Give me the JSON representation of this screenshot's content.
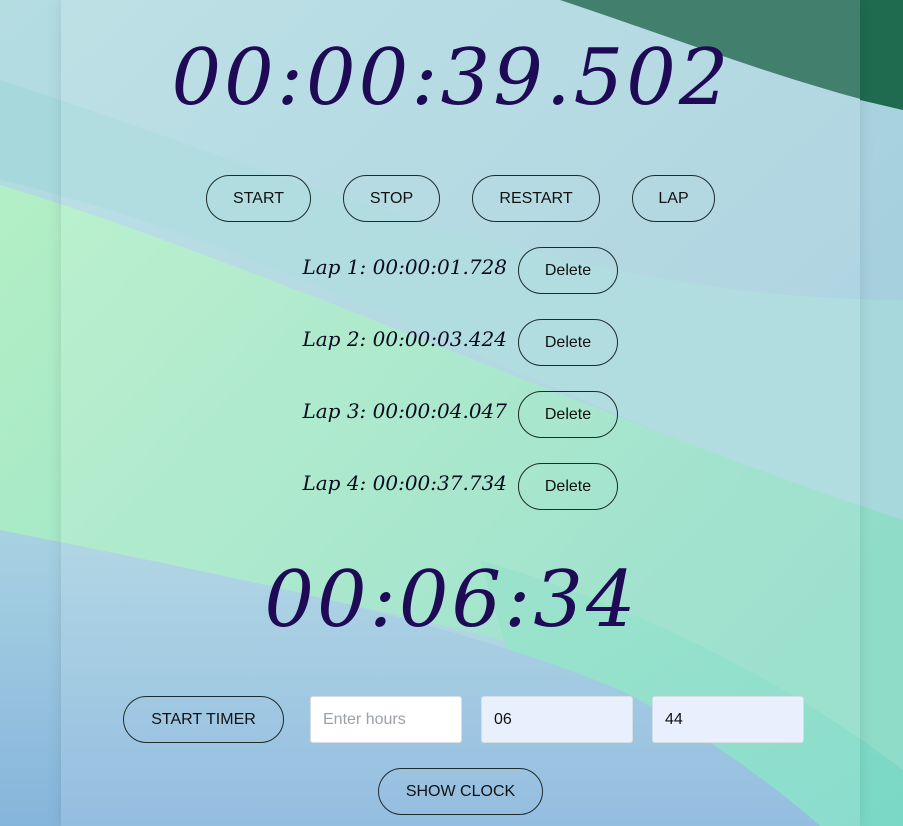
{
  "stopwatch": {
    "display": "00:00:39.502",
    "buttons": {
      "start": "START",
      "stop": "STOP",
      "restart": "RESTART",
      "lap": "LAP"
    }
  },
  "laps": [
    {
      "label": "Lap 1: 00:00:01.728",
      "delete_label": "Delete"
    },
    {
      "label": "Lap 2: 00:00:03.424",
      "delete_label": "Delete"
    },
    {
      "label": "Lap 3: 00:00:04.047",
      "delete_label": "Delete"
    },
    {
      "label": "Lap 4: 00:00:37.734",
      "delete_label": "Delete"
    }
  ],
  "timer": {
    "display": "00:06:34",
    "start_label": "START TIMER",
    "hours": {
      "value": "",
      "placeholder": "Enter hours"
    },
    "minutes": {
      "value": "06"
    },
    "seconds": {
      "value": "44"
    }
  },
  "show_clock_label": "SHOW CLOCK",
  "colors": {
    "display_text": "#1f0a55",
    "background_blue": "#a9d6e0",
    "background_green": "#b2edc8",
    "corner_dark_green": "#1f6b50"
  }
}
